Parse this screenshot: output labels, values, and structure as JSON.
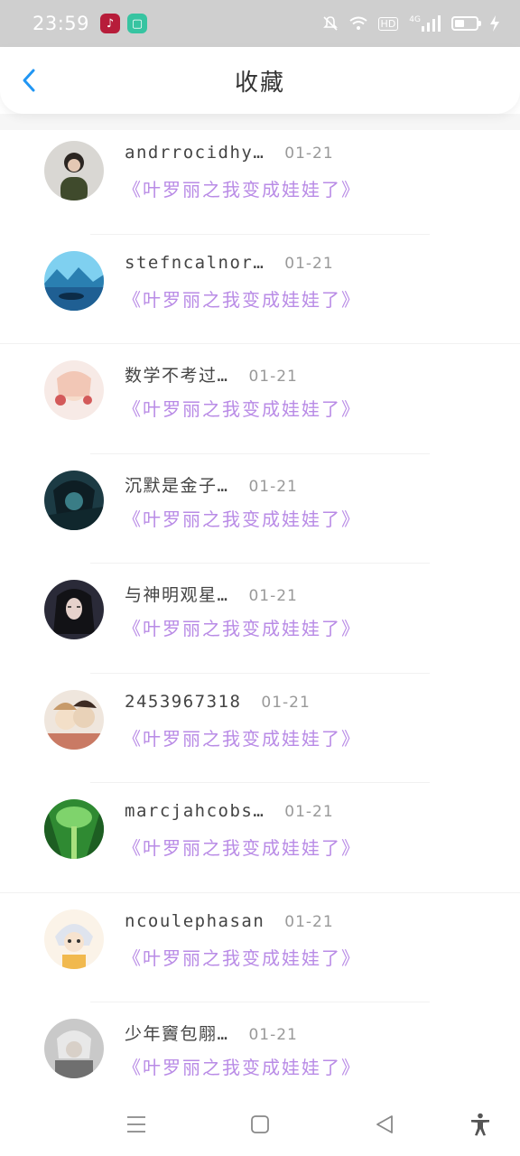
{
  "status_bar": {
    "time": "23:59",
    "icons": [
      "tiktok-icon",
      "chat-app-icon",
      "mute-icon",
      "wifi-icon",
      "hd-icon",
      "4g-signal-icon",
      "battery-icon",
      "charging-icon"
    ],
    "hd_label": "HD",
    "network_label": "4G"
  },
  "header": {
    "title": "收藏",
    "back_icon": "chevron-left-icon",
    "accent_color": "#2196f3"
  },
  "colors": {
    "book_title": "#b98be6",
    "name": "#444444",
    "date": "#999999"
  },
  "favorites": [
    {
      "name": "andrrocidhy…",
      "date": "01-21",
      "book": "《叶罗丽之我变成娃娃了》"
    },
    {
      "name": "stefncalnor…",
      "date": "01-21",
      "book": "《叶罗丽之我变成娃娃了》"
    },
    {
      "name": "数学不考过…",
      "date": "01-21",
      "book": "《叶罗丽之我变成娃娃了》"
    },
    {
      "name": "沉默是金子…",
      "date": "01-21",
      "book": "《叶罗丽之我变成娃娃了》"
    },
    {
      "name": "与神明观星…",
      "date": "01-21",
      "book": "《叶罗丽之我变成娃娃了》"
    },
    {
      "name": "2453967318",
      "date": "01-21",
      "book": "《叶罗丽之我变成娃娃了》"
    },
    {
      "name": "marcjahcobs…",
      "date": "01-21",
      "book": "《叶罗丽之我变成娃娃了》"
    },
    {
      "name": "ncoulephasan",
      "date": "01-21",
      "book": "《叶罗丽之我变成娃娃了》"
    },
    {
      "name": "少年竇包翢…",
      "date": "01-21",
      "book": "《叶罗丽之我变成娃娃了》"
    }
  ],
  "nav_bar": {
    "icons": [
      "menu-icon",
      "home-icon",
      "back-triangle-icon",
      "accessibility-icon"
    ]
  }
}
